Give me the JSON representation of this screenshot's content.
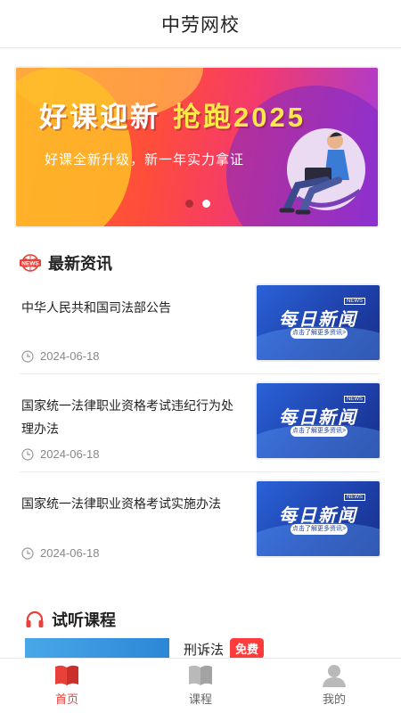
{
  "app": {
    "title": "中劳网校"
  },
  "banner": {
    "headline_1": "好课迎新",
    "headline_2": "抢跑2025",
    "subline": "好课全新升级，新一年实力拿证",
    "slides": 2,
    "active_slide": 2
  },
  "news_section": {
    "title": "最新资讯",
    "badge": "NEWS",
    "items": [
      {
        "title": "中华人民共和国司法部公告",
        "date": "2024-06-18",
        "thumb_title": "每日新闻",
        "thumb_sub": "点击了解更多资讯>"
      },
      {
        "title": "国家统一法律职业资格考试违纪行为处理办法",
        "date": "2024-06-18",
        "thumb_title": "每日新闻",
        "thumb_sub": "点击了解更多资讯>"
      },
      {
        "title": "国家统一法律职业资格考试实施办法",
        "date": "2024-06-18",
        "thumb_title": "每日新闻",
        "thumb_sub": "点击了解更多资讯>"
      }
    ]
  },
  "trial_section": {
    "title": "试听课程",
    "courses": [
      {
        "name": "刑诉法",
        "badge": "免费"
      }
    ]
  },
  "tabbar": {
    "items": [
      {
        "label": "首页",
        "icon": "book-icon",
        "active": true
      },
      {
        "label": "课程",
        "icon": "open-book-icon",
        "active": false
      },
      {
        "label": "我的",
        "icon": "user-icon",
        "active": false
      }
    ]
  },
  "colors": {
    "accent": "#e8413a",
    "news_thumb": "#1e3fa8",
    "free_badge": "#ff3b3b"
  }
}
